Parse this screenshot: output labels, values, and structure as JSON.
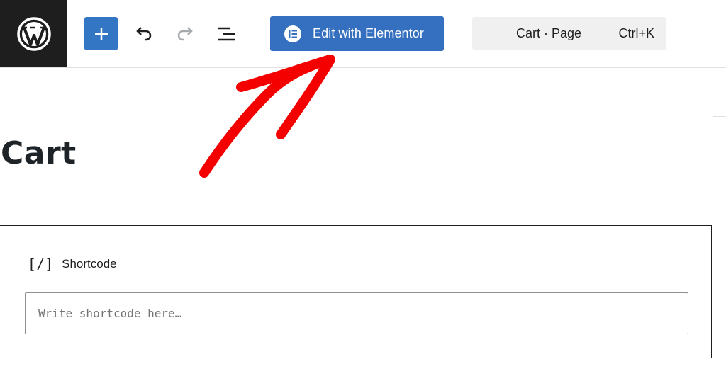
{
  "toolbar": {
    "logo_icon": "wordpress-logo",
    "add_icon": "plus-icon",
    "undo_icon": "undo-icon",
    "redo_icon": "redo-icon",
    "list_view_icon": "list-view-icon",
    "elementor_button_label": "Edit with Elementor",
    "elementor_icon": "elementor-icon",
    "command_bar": {
      "title": "Cart · Page",
      "shortcut": "Ctrl+K"
    }
  },
  "page": {
    "title": "Cart"
  },
  "shortcode_block": {
    "icon_text": "[/]",
    "label": "Shortcode",
    "input_value": "",
    "input_placeholder": "Write shortcode here…"
  },
  "colors": {
    "accent_blue": "#3377c4",
    "elementor_blue": "#3570c0",
    "annotation_red": "#f40000",
    "logo_bg": "#1e1e1e"
  }
}
